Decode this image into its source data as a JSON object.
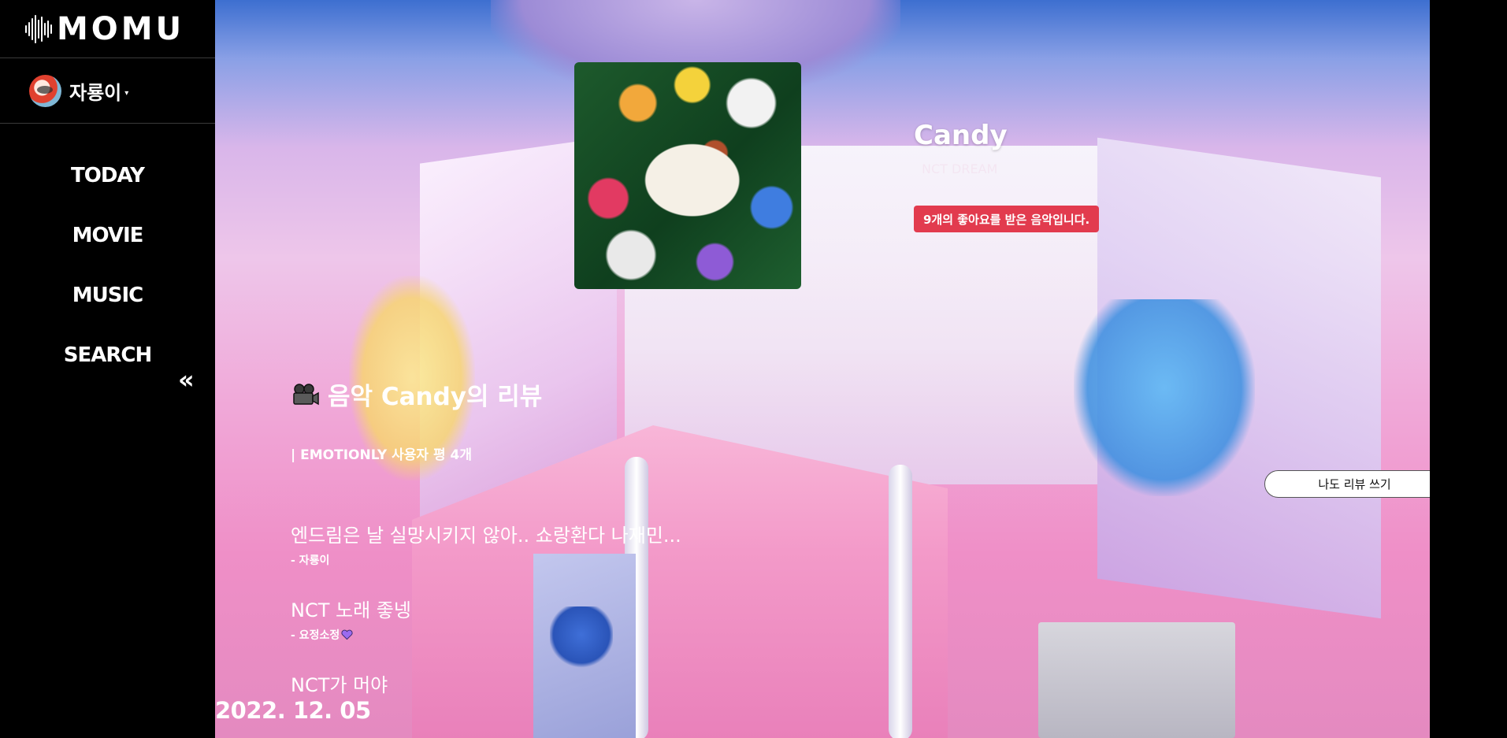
{
  "app": {
    "logo_text": "MOMU"
  },
  "user": {
    "name": "자룡이",
    "caret": "▾"
  },
  "nav": {
    "items": [
      {
        "label": "TODAY"
      },
      {
        "label": "MOVIE"
      },
      {
        "label": "MUSIC"
      },
      {
        "label": "SEARCH"
      }
    ],
    "collapse_label": "«"
  },
  "song": {
    "title": "Candy",
    "artist": "NCT DREAM",
    "likes_text": "9개의 좋아요를 받은 음악입니다."
  },
  "reviews": {
    "heading": "음악 Candy의 리뷰",
    "count_text": "| EMOTIONLY 사용자 평 4개",
    "write_button_label": "나도 리뷰 쓰기",
    "items": [
      {
        "text": "엔드림은 날 실망시키지 않아.. 쇼랑환다 나재민...",
        "author": "- 자룡이"
      },
      {
        "text": "NCT 노래 좋넹",
        "author": "- 요정소정"
      },
      {
        "text": "NCT가 머야",
        "author": ""
      }
    ]
  },
  "date": "2022. 12. 05",
  "colors": {
    "like_badge": "#e23b4e",
    "sidebar_bg": "#000000"
  }
}
